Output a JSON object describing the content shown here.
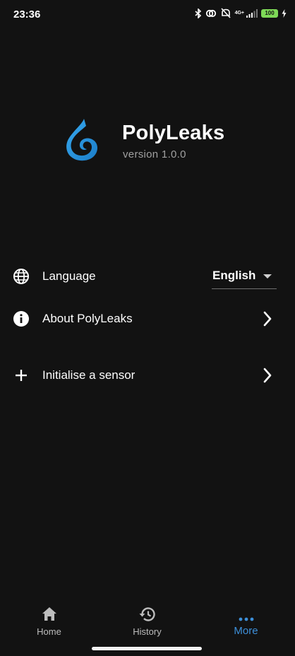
{
  "status_bar": {
    "time": "23:36",
    "network": "4G+",
    "battery": "100",
    "icons": [
      "bluetooth-icon",
      "link-icon",
      "mute-icon",
      "signal-icon",
      "battery-icon",
      "charging-icon"
    ],
    "battery_color": "#7ed957"
  },
  "app": {
    "name": "PolyLeaks",
    "version": "version 1.0.0",
    "logo_color": "#2f9be0"
  },
  "settings": {
    "language": {
      "label": "Language",
      "value": "English",
      "icon": "globe-icon"
    },
    "about": {
      "label": "About PolyLeaks",
      "icon": "info-icon"
    },
    "init_sensor": {
      "label": "Initialise a sensor",
      "icon": "plus-icon"
    }
  },
  "bottom_nav": {
    "items": [
      {
        "label": "Home",
        "icon": "home-icon"
      },
      {
        "label": "History",
        "icon": "history-icon"
      },
      {
        "label": "More",
        "icon": "more-dots-icon",
        "active": true
      }
    ],
    "active_color": "#3d8fd9"
  }
}
